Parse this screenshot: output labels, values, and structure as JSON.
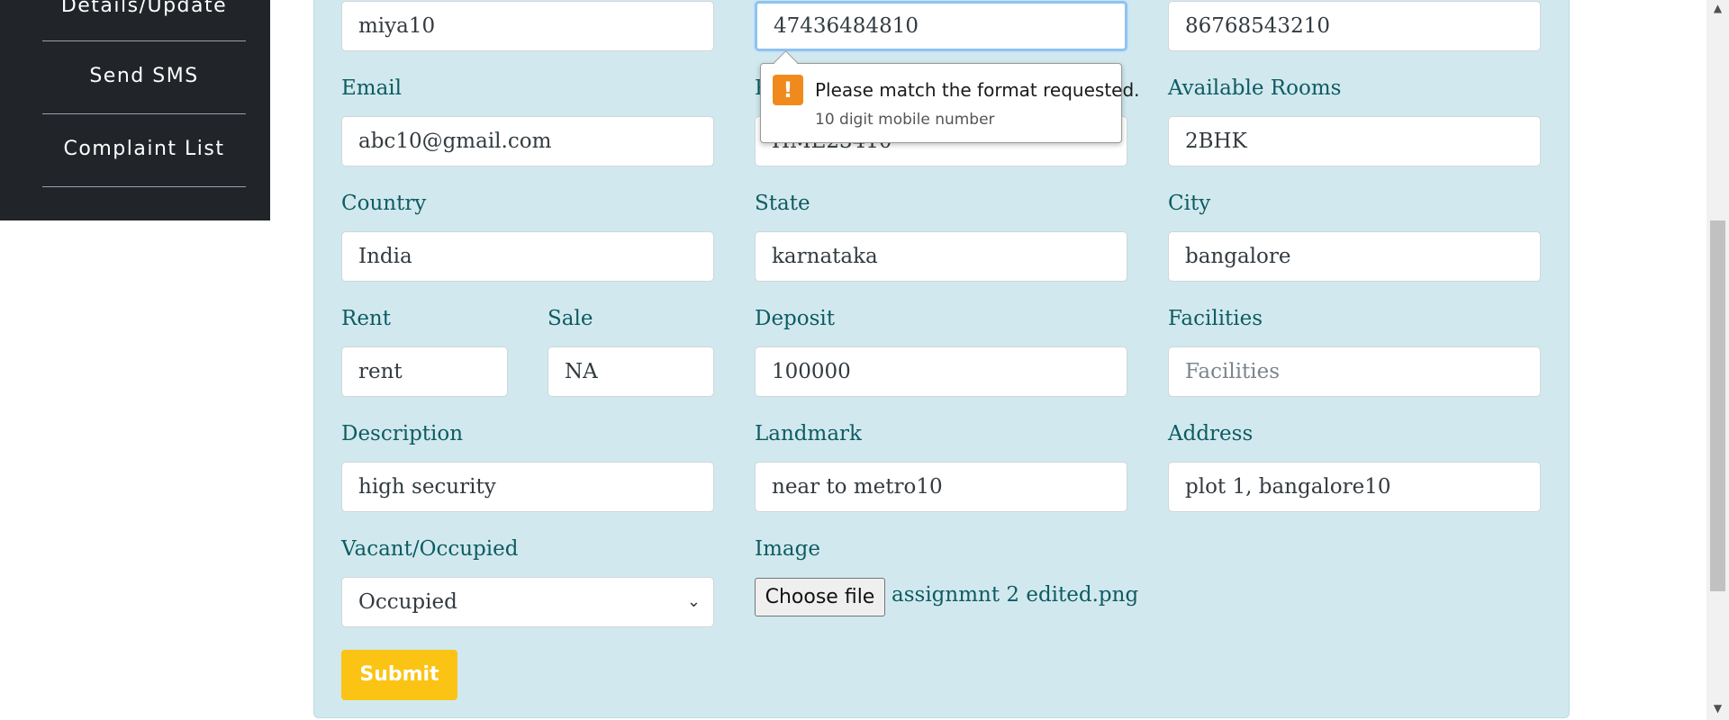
{
  "sidebar": {
    "items": [
      {
        "label": "Details/Update"
      },
      {
        "label": "Send SMS"
      },
      {
        "label": "Complaint List"
      }
    ]
  },
  "form": {
    "top_row": {
      "name_value": "miya10",
      "mobile_value": "47436484810",
      "alt_mobile_value": "86768543210"
    },
    "email": {
      "label": "Email",
      "value": "abc10@gmail.com"
    },
    "plot_number": {
      "label_fragment": "P",
      "value_fragment": "HME23410"
    },
    "available_rooms": {
      "label": "Available Rooms",
      "value": "2BHK"
    },
    "country": {
      "label": "Country",
      "value": "India"
    },
    "state": {
      "label": "State",
      "value": "karnataka"
    },
    "city": {
      "label": "City",
      "value": "bangalore"
    },
    "rent": {
      "label": "Rent",
      "value": "rent"
    },
    "sale": {
      "label": "Sale",
      "value": "NA"
    },
    "deposit": {
      "label": "Deposit",
      "value": "100000"
    },
    "facilities": {
      "label": "Facilities",
      "placeholder": "Facilities"
    },
    "description": {
      "label": "Description",
      "value": "high security"
    },
    "landmark": {
      "label": "Landmark",
      "value": "near to metro10"
    },
    "address": {
      "label": "Address",
      "value": "plot 1, bangalore10"
    },
    "vacancy": {
      "label": "Vacant/Occupied",
      "selected": "Occupied"
    },
    "image": {
      "label": "Image",
      "button_label": "Choose file",
      "file_name": "assignmnt 2 edited.png"
    },
    "submit_label": "Submit"
  },
  "tooltip": {
    "icon": "warning-icon",
    "message": "Please match the format requested.",
    "hint": "10 digit mobile number"
  },
  "colors": {
    "sidebar_bg": "#212529",
    "panel_bg": "#d1e9ee",
    "label_color": "#0e5b63",
    "submit_bg": "#fbc313",
    "warning": "#f08a1c"
  }
}
